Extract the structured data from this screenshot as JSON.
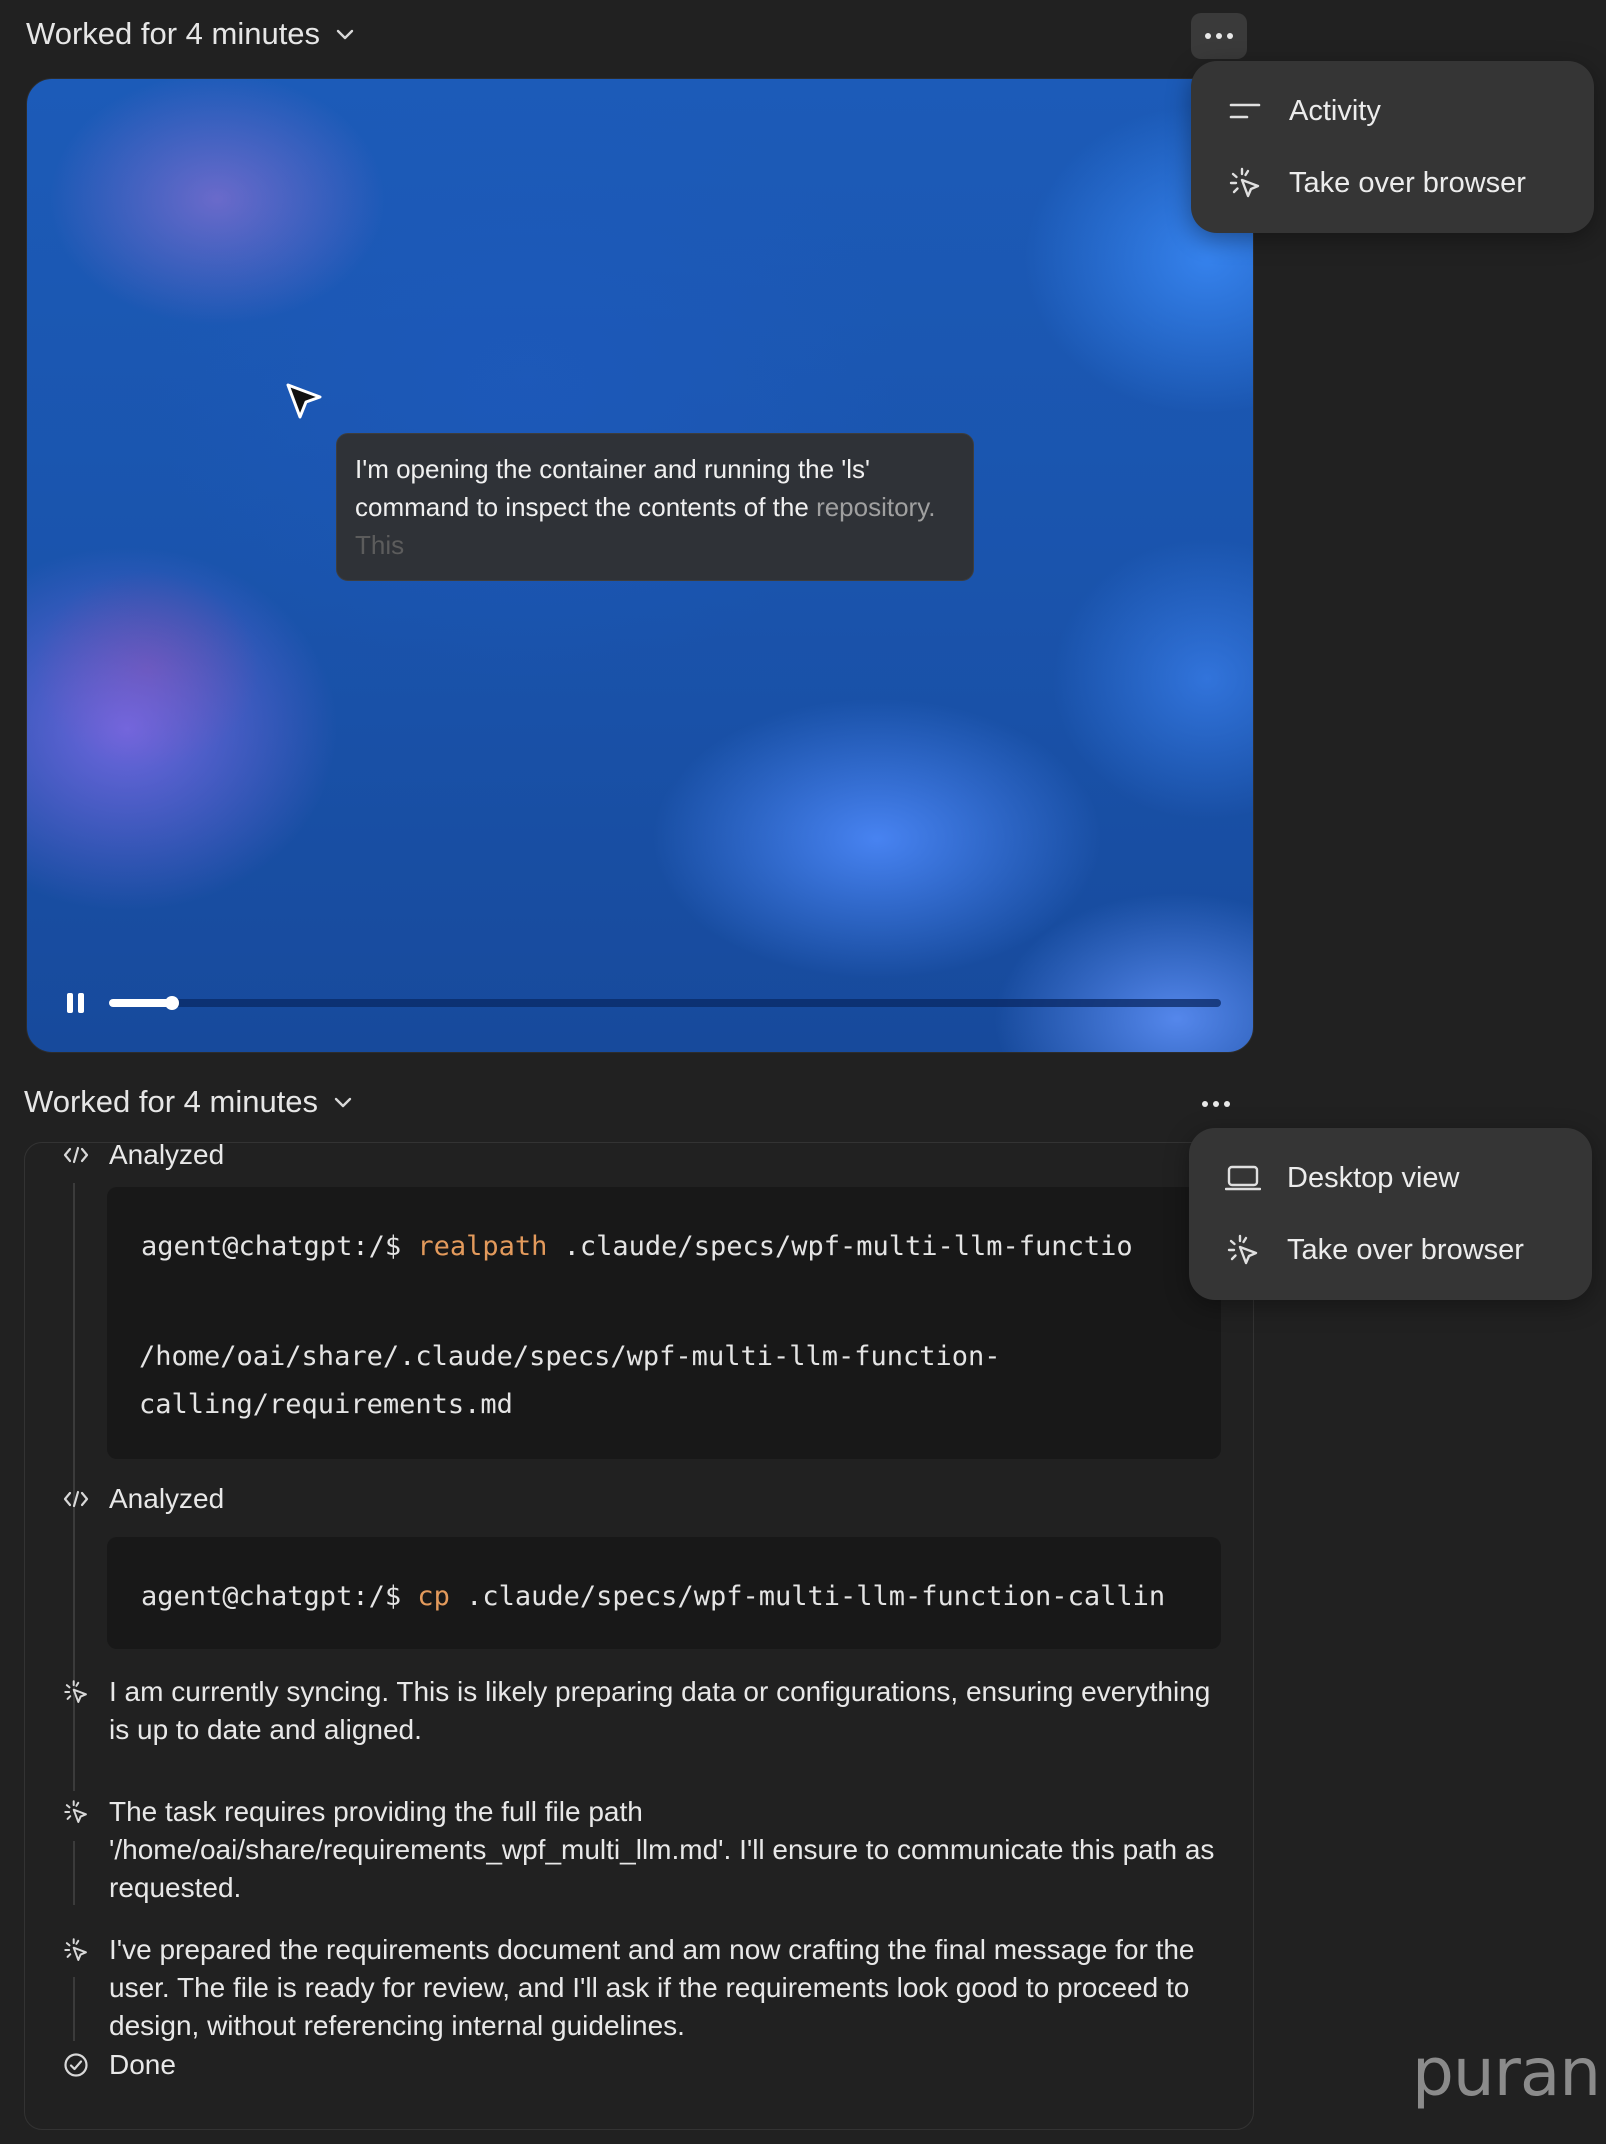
{
  "top_section": {
    "worked_label": "Worked for 4 minutes",
    "menu": [
      {
        "label": "Activity",
        "icon": "activity-lines-icon"
      },
      {
        "label": "Take over browser",
        "icon": "sparkle-cursor-icon"
      }
    ]
  },
  "video": {
    "caption_main": "I'm opening the container and running the 'ls' command to inspect the contents of the",
    "caption_fading": "repository.",
    "caption_faded": "This",
    "progress": 0.057
  },
  "bottom_section": {
    "worked_label": "Worked for 4 minutes",
    "menu": [
      {
        "label": "Desktop view",
        "icon": "laptop-icon"
      },
      {
        "label": "Take over browser",
        "icon": "sparkle-cursor-icon"
      }
    ]
  },
  "log": {
    "analyzed_1": "Analyzed",
    "code_1": {
      "prompt": "agent@chatgpt:/$ ",
      "command": "realpath",
      "args": " .claude/specs/wpf-multi-llm-functio",
      "output_line_1": "/home/oai/share/.claude/specs/wpf-multi-llm-function-",
      "output_line_2": "calling/requirements.md"
    },
    "analyzed_2": "Analyzed",
    "code_2": {
      "prompt": "agent@chatgpt:/$ ",
      "command": "cp",
      "args": " .claude/specs/wpf-multi-llm-function-callin"
    },
    "thoughts": [
      "I am currently syncing. This is likely preparing data or configurations, ensuring everything is up to date and aligned.",
      "The task requires providing the full file path '/home/oai/share/requirements_wpf_multi_llm.md'. I'll ensure to communicate this path as requested.",
      "I've prepared the requirements document and am now crafting the final message for the user. The file is ready for review, and I'll ask if the requirements look good to proceed to design, without referencing internal guidelines."
    ],
    "done_label": "Done"
  },
  "watermark": "puran"
}
